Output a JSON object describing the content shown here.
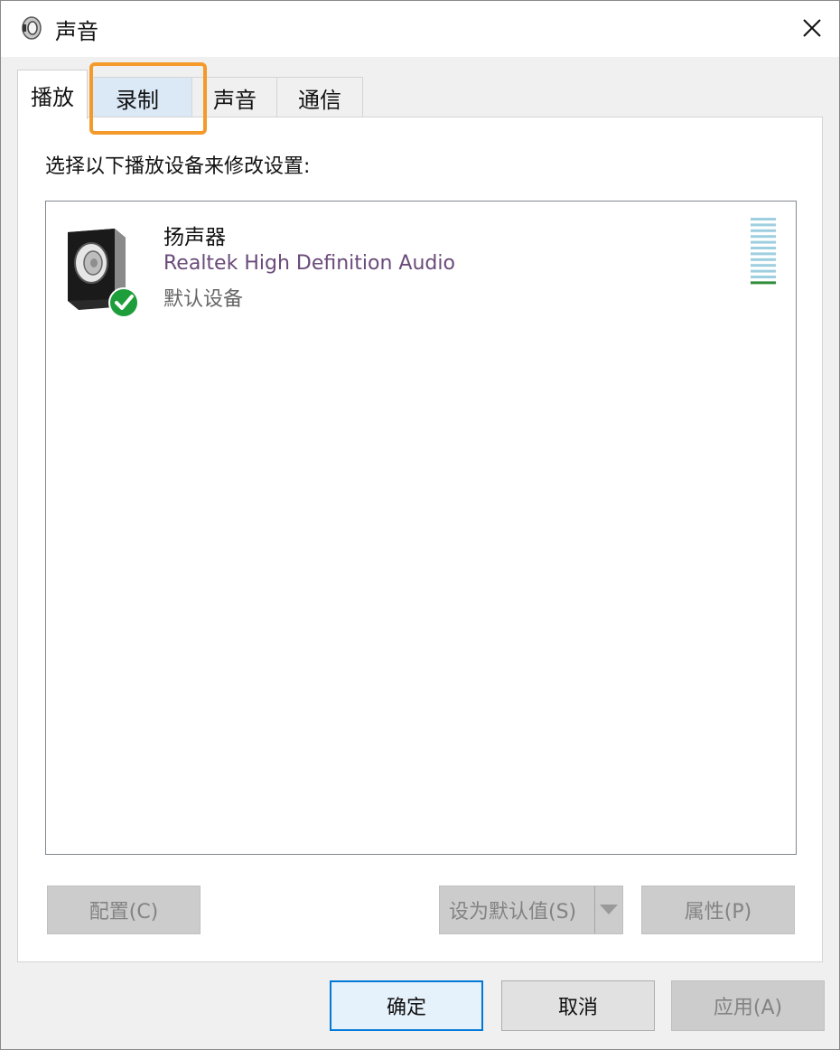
{
  "window": {
    "title": "声音",
    "icon": "speaker-icon",
    "close_icon": "close-icon"
  },
  "tabs": [
    {
      "label": "播放",
      "active": true
    },
    {
      "label": "录制",
      "active": false,
      "highlighted": true
    },
    {
      "label": "声音",
      "active": false
    },
    {
      "label": "通信",
      "active": false
    }
  ],
  "panel": {
    "instruction": "选择以下播放设备来修改设置:"
  },
  "devices": [
    {
      "name": "扬声器",
      "driver": "Realtek High Definition Audio",
      "status": "默认设备",
      "icon": "speaker-device-icon",
      "badge": "check-icon",
      "level": 0.1
    }
  ],
  "panel_buttons": {
    "configure": "配置(C)",
    "set_default": "设为默认值(S)",
    "properties": "属性(P)"
  },
  "dialog_buttons": {
    "ok": "确定",
    "cancel": "取消",
    "apply": "应用(A)"
  },
  "colors": {
    "highlight": "#f39a2b",
    "accent": "#0078d7",
    "check_badge": "#1e9e3a",
    "level_active": "#2e8b3a",
    "level_idle": "#9ecfe0"
  }
}
